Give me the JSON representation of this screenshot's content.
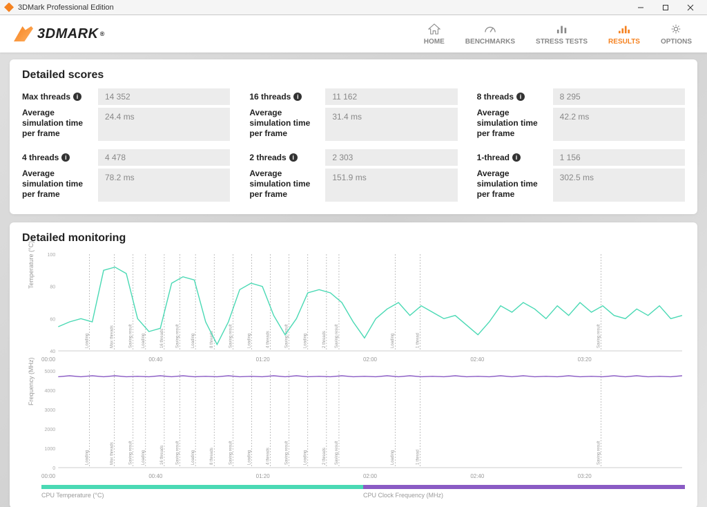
{
  "titlebar": {
    "title": "3DMark Professional Edition"
  },
  "brand": "3DMARK",
  "nav": {
    "home": "HOME",
    "benchmarks": "BENCHMARKS",
    "stress": "STRESS TESTS",
    "results": "RESULTS",
    "options": "OPTIONS"
  },
  "scores_title": "Detailed scores",
  "scores": [
    {
      "label": "Max threads",
      "value": "14 352",
      "time_label": "Average simulation time per frame",
      "time": "24.4 ms"
    },
    {
      "label": "16 threads",
      "value": "11 162",
      "time_label": "Average simulation time per frame",
      "time": "31.4 ms"
    },
    {
      "label": "8 threads",
      "value": "8 295",
      "time_label": "Average simulation time per frame",
      "time": "42.2 ms"
    },
    {
      "label": "4 threads",
      "value": "4 478",
      "time_label": "Average simulation time per frame",
      "time": "78.2 ms"
    },
    {
      "label": "2 threads",
      "value": "2 303",
      "time_label": "Average simulation time per frame",
      "time": "151.9 ms"
    },
    {
      "label": "1-thread",
      "value": "1 156",
      "time_label": "Average simulation time per frame",
      "time": "302.5 ms"
    }
  ],
  "monitoring_title": "Detailed monitoring",
  "chart_temp": {
    "ylabel": "Temperature (°C)"
  },
  "chart_clk": {
    "ylabel": "Frequency (MHz)"
  },
  "x_ticks": [
    "00:00",
    "00:40",
    "01:20",
    "02:00",
    "02:40",
    "03:20"
  ],
  "legend": {
    "temp": "CPU Temperature (°C)",
    "clk": "CPU Clock Frequency (MHz)"
  },
  "event_labels": [
    "Loading",
    "Max threads",
    "Saving result",
    "Loading",
    "16 threads",
    "Saving result",
    "Loading",
    "8 threads",
    "Saving result",
    "Loading",
    "4 threads",
    "Saving result",
    "Loading",
    "2 threads",
    "Saving result",
    "Loading",
    "1 thread",
    "Saving result"
  ],
  "chart_data": [
    {
      "type": "line",
      "title": "CPU Temperature",
      "ylabel": "Temperature (°C)",
      "ylim": [
        40,
        100
      ],
      "series": [
        {
          "name": "CPU Temperature (°C)",
          "values": [
            55,
            58,
            60,
            58,
            90,
            92,
            88,
            60,
            52,
            54,
            82,
            86,
            84,
            58,
            44,
            58,
            78,
            82,
            80,
            62,
            50,
            60,
            76,
            78,
            76,
            70,
            58,
            48,
            60,
            66,
            70,
            62,
            68,
            64,
            60,
            62,
            56,
            50,
            58,
            68,
            64,
            70,
            66,
            60,
            68,
            62,
            70,
            64,
            68,
            62,
            60,
            66,
            62,
            68,
            60,
            62
          ]
        }
      ],
      "event_positions_pct": [
        5,
        9,
        12,
        14,
        17,
        19.5,
        22,
        25,
        28,
        31,
        34,
        37,
        40,
        43,
        45,
        54,
        58,
        87
      ]
    },
    {
      "type": "line",
      "title": "CPU Clock Frequency",
      "ylabel": "Frequency (MHz)",
      "ylim": [
        0,
        5000
      ],
      "series": [
        {
          "name": "CPU Clock Frequency (MHz)",
          "values": [
            4700,
            4750,
            4700,
            4750,
            4700,
            4750,
            4700,
            4720,
            4700,
            4750,
            4700,
            4750,
            4700,
            4720,
            4700,
            4750,
            4700,
            4720,
            4700,
            4750,
            4700,
            4750,
            4700,
            4720,
            4700,
            4750,
            4700,
            4720,
            4700,
            4750,
            4700,
            4750,
            4700,
            4720,
            4700,
            4750,
            4700,
            4720,
            4700,
            4750,
            4700,
            4750,
            4700,
            4720,
            4700,
            4750,
            4700,
            4720,
            4700,
            4750,
            4700,
            4750,
            4700,
            4720,
            4700,
            4750
          ]
        }
      ]
    }
  ]
}
